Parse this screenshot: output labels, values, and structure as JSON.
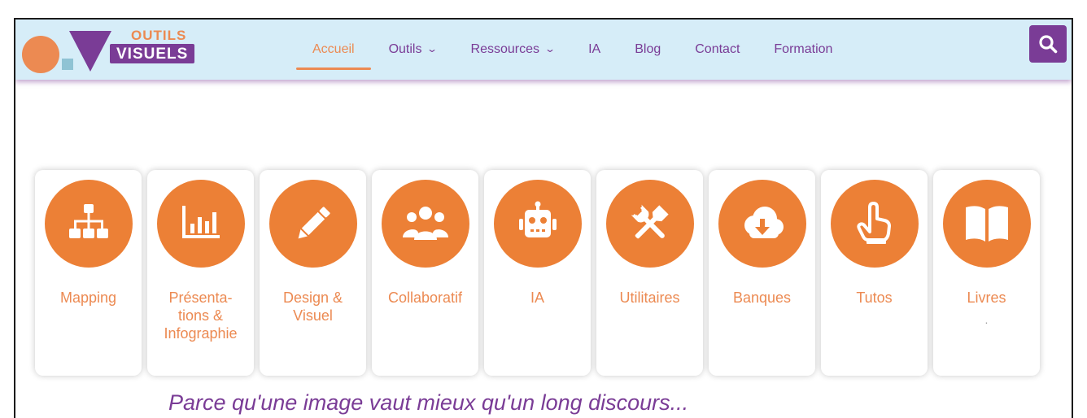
{
  "logo": {
    "line1": "OUTILS",
    "line2": "VISUELS"
  },
  "nav": {
    "items": [
      {
        "label": "Accueil",
        "active": true,
        "dropdown": false
      },
      {
        "label": "Outils",
        "dropdown": true
      },
      {
        "label": "Ressources",
        "dropdown": true
      },
      {
        "label": "IA",
        "dropdown": false
      },
      {
        "label": "Blog",
        "dropdown": false
      },
      {
        "label": "Contact",
        "dropdown": false
      },
      {
        "label": "Formation",
        "dropdown": false
      }
    ],
    "chevron": "⌄"
  },
  "search": {
    "icon": "search-icon"
  },
  "categories": [
    {
      "label": "Mapping",
      "icon": "sitemap-icon"
    },
    {
      "label": "Présenta-\ntions &\nInfographie",
      "icon": "chart-icon"
    },
    {
      "label": "Design &\nVisuel",
      "icon": "pencil-icon"
    },
    {
      "label": "Collaboratif",
      "icon": "users-icon"
    },
    {
      "label": "IA",
      "icon": "robot-icon"
    },
    {
      "label": "Utilitaires",
      "icon": "tools-icon"
    },
    {
      "label": "Banques",
      "icon": "cloud-download-icon"
    },
    {
      "label": "Tutos",
      "icon": "hand-pointer-icon"
    },
    {
      "label": "Livres",
      "icon": "book-icon",
      "sub": "."
    }
  ],
  "tagline": "Parce qu'une image vaut mieux qu'un long discours...",
  "colors": {
    "brand_purple": "#7a3c96",
    "brand_orange": "#ec8036",
    "header_bg": "#d6edf8"
  }
}
